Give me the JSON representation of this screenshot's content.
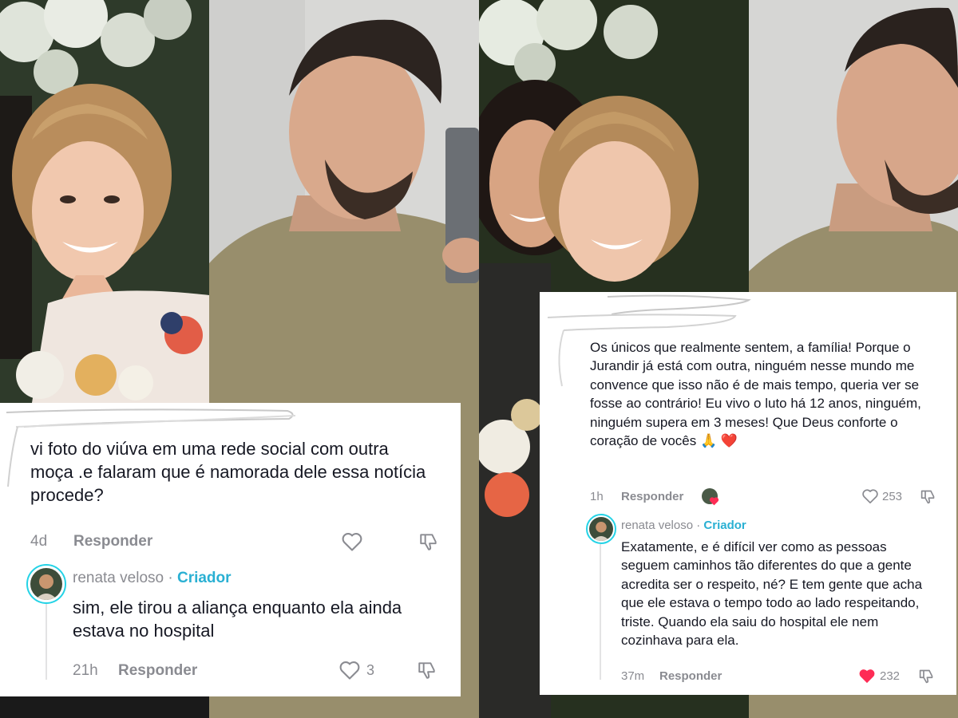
{
  "left_card": {
    "comment": {
      "text": "vi foto do viúva em uma rede social com outra moça .e falaram que é namorada dele essa notícia procede?",
      "time": "4d",
      "reply_label": "Responder",
      "like_icon": "heart-outline-icon",
      "dislike_icon": "thumbs-down-icon"
    },
    "reply": {
      "username": "renata veloso",
      "separator": "·",
      "badge": "Criador",
      "text": "sim, ele tirou a aliança enquanto ela ainda estava no hospital",
      "time": "21h",
      "reply_label": "Responder",
      "likes": "3",
      "like_icon": "heart-outline-icon",
      "dislike_icon": "thumbs-down-icon"
    }
  },
  "right_card": {
    "comment": {
      "text": "Os únicos que realmente sentem, a família! Porque o Jurandir já está com outra, ninguém nesse mundo me convence que isso não é de mais tempo, queria ver se fosse ao contrário! Eu vivo o luto há 12 anos, ninguém, ninguém supera em 3 meses! Que Deus conforte o coração de vocês 🙏 ❤️",
      "time": "1h",
      "reply_label": "Responder",
      "likes": "253",
      "like_icon": "heart-outline-icon",
      "dislike_icon": "thumbs-down-icon"
    },
    "reply": {
      "username": "renata veloso",
      "separator": "·",
      "badge": "Criador",
      "text": "Exatamente, e é difícil ver como as pessoas seguem caminhos tão diferentes do que a gente acredita ser o respeito, né? E tem gente que acha que ele estava o tempo todo ao lado respeitando, triste. Quando ela saiu do hospital ele nem cozinhava para ela.",
      "time": "37m",
      "reply_label": "Responder",
      "likes": "232",
      "like_icon": "heart-filled-icon",
      "dislike_icon": "thumbs-down-icon"
    }
  },
  "colors": {
    "creator": "#2ab0d3",
    "liked_heart": "#fe2c55",
    "meta_gray": "#8a8b91",
    "text": "#161823"
  }
}
